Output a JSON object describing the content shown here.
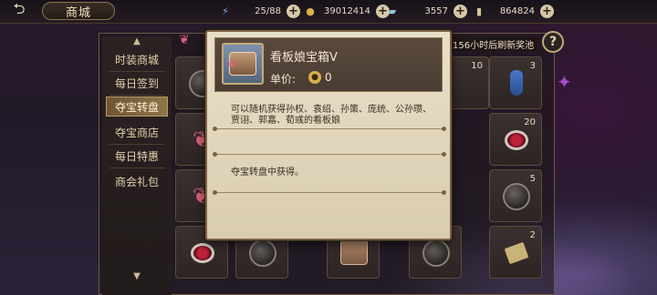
{
  "header": {
    "back_icon": "back-arrow-icon",
    "title": "商城",
    "resources": [
      {
        "icon": "lightning-icon",
        "value": "25/88"
      },
      {
        "icon": "coin-icon",
        "value": "39012414"
      },
      {
        "icon": "ticket-icon",
        "value": "3557"
      },
      {
        "icon": "scroll-icon",
        "value": "864824"
      }
    ]
  },
  "menu": {
    "items": [
      {
        "label": "时装商城",
        "active": false
      },
      {
        "label": "每日签到",
        "active": false
      },
      {
        "label": "夺宝转盘",
        "active": true
      },
      {
        "label": "夺宝商店",
        "active": false
      },
      {
        "label": "每日特惠",
        "active": false
      },
      {
        "label": "商会礼包",
        "active": false
      }
    ]
  },
  "grid": {
    "counts": [
      "10",
      "3",
      "20",
      "5",
      "2"
    ]
  },
  "refresh_text": "156小时后刷新奖池",
  "tooltip": {
    "name": "看板娘宝箱V",
    "price_label": "单价:",
    "price": "0",
    "description": "可以随机获得孙权、袁绍、孙策、庞统、公孙瓒、贾诩、郭嘉、荀彧的看板娘",
    "source": "夺宝转盘中获得。"
  },
  "colors": {
    "menu_active": "#8e7448",
    "tooltip_bg": "#e9dfc8",
    "accent_gold": "#c2ab7a"
  }
}
